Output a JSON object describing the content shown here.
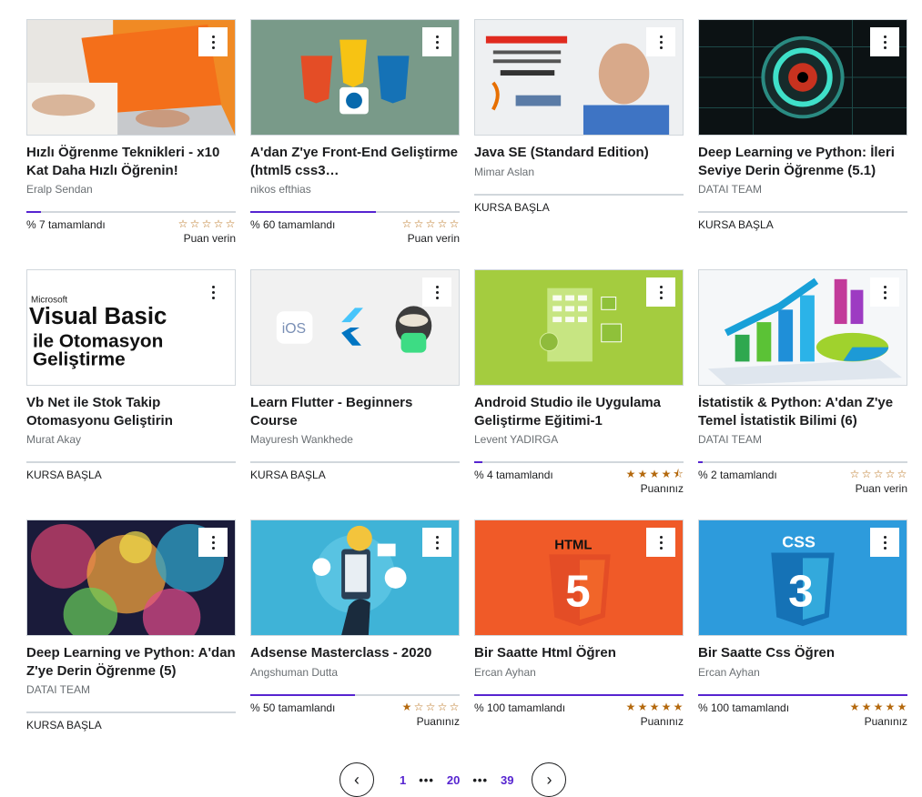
{
  "courses": [
    {
      "title": "Hızlı Öğrenme Teknikleri - x10 Kat Daha Hızlı Öğrenin!",
      "author": "Eralp Sendan",
      "progress_text": "% 7 tamamlandı",
      "progress": 7,
      "stars": "☆☆☆☆☆",
      "rating_label": "Puan verin",
      "thumb": "laptop-photo"
    },
    {
      "title": "A'dan Z'ye Front-End Geliştirme (html5 css3…",
      "author": "nikos efthias",
      "progress_text": "% 60 tamamlandı",
      "progress": 60,
      "stars": "☆☆☆☆☆",
      "rating_label": "Puan verin",
      "thumb": "html-css-js-logos"
    },
    {
      "title": "Java SE (Standard Edition)",
      "author": "Mimar Aslan",
      "start_label": "KURSA BAŞLA",
      "thumb": "oracle-java"
    },
    {
      "title": "Deep Learning ve Python: İleri Seviye Derin Öğrenme (5.1)",
      "author": "DATAI TEAM",
      "start_label": "KURSA BAŞLA",
      "thumb": "tech-eye"
    },
    {
      "title": "Vb Net ile Stok Takip Otomasyonu Geliştirin",
      "author": "Murat Akay",
      "start_label": "KURSA BAŞLA",
      "thumb": "visual-basic",
      "thumb_text": [
        "Microsoft",
        "Visual Basic",
        "ile Otomasyon",
        "Geliştirme"
      ]
    },
    {
      "title": "Learn Flutter - Beginners Course",
      "author": "Mayuresh Wankhede",
      "start_label": "KURSA BAŞLA",
      "thumb": "flutter-ios-android",
      "thumb_text": [
        "iOS"
      ]
    },
    {
      "title": "Android Studio ile Uygulama Geliştirme Eğitimi-1",
      "author": "Levent YADIRGA",
      "progress_text": "% 4 tamamlandı",
      "progress": 4,
      "stars": "★★★★⯪",
      "rating_label": "Puanınız",
      "thumb": "android-app"
    },
    {
      "title": "İstatistik & Python: A'dan Z'ye Temel İstatistik Bilimi (6)",
      "author": "DATAI TEAM",
      "progress_text": "% 2 tamamlandı",
      "progress": 2,
      "stars": "☆☆☆☆☆",
      "rating_label": "Puan verin",
      "thumb": "3d-chart"
    },
    {
      "title": "Deep Learning ve Python: A'dan Z'ye Derin Öğrenme (5)",
      "author": "DATAI TEAM",
      "start_label": "KURSA BAŞLA",
      "thumb": "colorful-brain"
    },
    {
      "title": "Adsense Masterclass - 2020",
      "author": "Angshuman Dutta",
      "progress_text": "% 50 tamamlandı",
      "progress": 50,
      "stars": "★☆☆☆☆",
      "rating_label": "Puanınız",
      "thumb": "adsense-phone"
    },
    {
      "title": "Bir Saatte Html Öğren",
      "author": "Ercan Ayhan",
      "progress_text": "% 100 tamamlandı",
      "progress": 100,
      "stars": "★★★★★",
      "rating_label": "Puanınız",
      "thumb": "html5-shield",
      "thumb_text": [
        "HTML",
        "5"
      ]
    },
    {
      "title": "Bir Saatte Css Öğren",
      "author": "Ercan Ayhan",
      "progress_text": "% 100 tamamlandı",
      "progress": 100,
      "stars": "★★★★★",
      "rating_label": "Puanınız",
      "thumb": "css3-shield",
      "thumb_text": [
        "CSS",
        "3"
      ]
    }
  ],
  "pagination": {
    "prev_icon": "‹",
    "next_icon": "›",
    "page_first": "1",
    "page_current": "20",
    "page_last": "39",
    "ellipsis": "•••"
  },
  "colors": {
    "accent": "#5624d0",
    "star": "#b4690e",
    "muted_text": "#6a6f73"
  }
}
